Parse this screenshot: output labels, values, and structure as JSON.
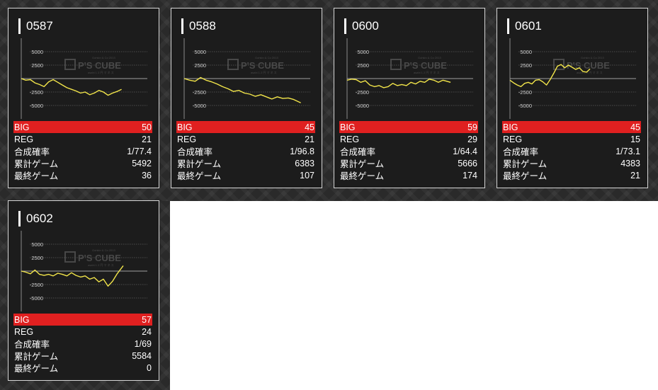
{
  "colors": {
    "big_row": "#e02020",
    "line": "#f2e54a",
    "card_bg": "#1c1c1c"
  },
  "watermark": {
    "brand": "P'S CUBE",
    "sub": "Gohkin & Co 2013",
    "tagline": "asahi 1 2 円 マ ネ ス"
  },
  "labels": {
    "big": "BIG",
    "reg": "REG",
    "rate": "合成確率",
    "total_games": "累計ゲーム",
    "last_game": "最終ゲーム"
  },
  "cards": [
    {
      "machine": "0587",
      "big": "50",
      "reg": "21",
      "rate": "1/77.4",
      "total_games": "5492",
      "last_game": "36",
      "chart_data": {
        "type": "line",
        "y_ticks": [
          "5000",
          "2500",
          "-2500",
          "-5000"
        ],
        "ylim": [
          -7500,
          7500
        ],
        "x_range": [
          0,
          5492
        ],
        "points": [
          [
            0,
            0
          ],
          [
            250,
            -300
          ],
          [
            500,
            -200
          ],
          [
            750,
            -800
          ],
          [
            1000,
            -1100
          ],
          [
            1250,
            -1500
          ],
          [
            1500,
            -600
          ],
          [
            1750,
            -200
          ],
          [
            2000,
            -700
          ],
          [
            2250,
            -1200
          ],
          [
            2500,
            -1700
          ],
          [
            2750,
            -2000
          ],
          [
            3000,
            -2300
          ],
          [
            3250,
            -2700
          ],
          [
            3500,
            -2500
          ],
          [
            3750,
            -3000
          ],
          [
            4000,
            -2700
          ],
          [
            4250,
            -2200
          ],
          [
            4500,
            -2500
          ],
          [
            4750,
            -3100
          ],
          [
            5000,
            -2700
          ],
          [
            5250,
            -2400
          ],
          [
            5492,
            -2000
          ]
        ]
      }
    },
    {
      "machine": "0588",
      "big": "45",
      "reg": "21",
      "rate": "1/96.8",
      "total_games": "6383",
      "last_game": "107",
      "chart_data": {
        "type": "line",
        "y_ticks": [
          "5000",
          "2500",
          "-2500",
          "-5000"
        ],
        "ylim": [
          -7500,
          7500
        ],
        "x_range": [
          0,
          6383
        ],
        "points": [
          [
            0,
            0
          ],
          [
            300,
            -300
          ],
          [
            600,
            -500
          ],
          [
            900,
            200
          ],
          [
            1200,
            -300
          ],
          [
            1500,
            -600
          ],
          [
            1800,
            -1000
          ],
          [
            2100,
            -1500
          ],
          [
            2400,
            -1900
          ],
          [
            2700,
            -2400
          ],
          [
            3000,
            -2200
          ],
          [
            3300,
            -2700
          ],
          [
            3600,
            -2900
          ],
          [
            3900,
            -3300
          ],
          [
            4200,
            -3000
          ],
          [
            4500,
            -3400
          ],
          [
            4800,
            -3800
          ],
          [
            5100,
            -3400
          ],
          [
            5400,
            -3700
          ],
          [
            5700,
            -3600
          ],
          [
            6000,
            -3900
          ],
          [
            6383,
            -4500
          ]
        ]
      }
    },
    {
      "machine": "0600",
      "big": "59",
      "reg": "29",
      "rate": "1/64.4",
      "total_games": "5666",
      "last_game": "174",
      "chart_data": {
        "type": "line",
        "y_ticks": [
          "5000",
          "2500",
          "-2500",
          "-5000"
        ],
        "ylim": [
          -7500,
          7500
        ],
        "x_range": [
          0,
          5666
        ],
        "points": [
          [
            0,
            -300
          ],
          [
            250,
            -100
          ],
          [
            500,
            -200
          ],
          [
            750,
            -700
          ],
          [
            1000,
            -400
          ],
          [
            1250,
            -1200
          ],
          [
            1500,
            -1500
          ],
          [
            1750,
            -1300
          ],
          [
            2000,
            -1700
          ],
          [
            2250,
            -1500
          ],
          [
            2500,
            -900
          ],
          [
            2750,
            -1300
          ],
          [
            3000,
            -1100
          ],
          [
            3250,
            -1300
          ],
          [
            3500,
            -700
          ],
          [
            3750,
            -1000
          ],
          [
            4000,
            -500
          ],
          [
            4250,
            -700
          ],
          [
            4500,
            -100
          ],
          [
            4750,
            -300
          ],
          [
            5000,
            -700
          ],
          [
            5250,
            -300
          ],
          [
            5666,
            -700
          ]
        ]
      }
    },
    {
      "machine": "0601",
      "big": "45",
      "reg": "15",
      "rate": "1/73.1",
      "total_games": "4383",
      "last_game": "21",
      "chart_data": {
        "type": "line",
        "y_ticks": [
          "5000",
          "2500",
          "-2500",
          "-5000"
        ],
        "ylim": [
          -7500,
          7500
        ],
        "x_range": [
          0,
          4383
        ],
        "points": [
          [
            0,
            -300
          ],
          [
            200,
            -800
          ],
          [
            400,
            -1200
          ],
          [
            600,
            -1500
          ],
          [
            800,
            -900
          ],
          [
            1000,
            -700
          ],
          [
            1200,
            -1000
          ],
          [
            1400,
            -300
          ],
          [
            1600,
            -200
          ],
          [
            1800,
            -600
          ],
          [
            2000,
            -1200
          ],
          [
            2200,
            -200
          ],
          [
            2400,
            1000
          ],
          [
            2600,
            2300
          ],
          [
            2800,
            2600
          ],
          [
            3000,
            2000
          ],
          [
            3200,
            2500
          ],
          [
            3400,
            2100
          ],
          [
            3600,
            1700
          ],
          [
            3800,
            2000
          ],
          [
            4000,
            1300
          ],
          [
            4200,
            1200
          ],
          [
            4383,
            1800
          ]
        ]
      }
    },
    {
      "machine": "0602",
      "big": "57",
      "reg": "24",
      "rate": "1/69",
      "total_games": "5584",
      "last_game": "0",
      "chart_data": {
        "type": "line",
        "y_ticks": [
          "5000",
          "2500",
          "-2500",
          "-5000"
        ],
        "ylim": [
          -7500,
          7500
        ],
        "x_range": [
          0,
          5584
        ],
        "points": [
          [
            0,
            0
          ],
          [
            250,
            -200
          ],
          [
            500,
            -500
          ],
          [
            750,
            200
          ],
          [
            1000,
            -600
          ],
          [
            1250,
            -800
          ],
          [
            1500,
            -600
          ],
          [
            1750,
            -900
          ],
          [
            2000,
            -400
          ],
          [
            2250,
            -600
          ],
          [
            2500,
            -900
          ],
          [
            2750,
            -300
          ],
          [
            3000,
            -800
          ],
          [
            3250,
            -1100
          ],
          [
            3500,
            -900
          ],
          [
            3750,
            -1500
          ],
          [
            4000,
            -1200
          ],
          [
            4250,
            -2000
          ],
          [
            4500,
            -1500
          ],
          [
            4750,
            -2800
          ],
          [
            5000,
            -1900
          ],
          [
            5250,
            -500
          ],
          [
            5584,
            1000
          ]
        ]
      }
    }
  ]
}
